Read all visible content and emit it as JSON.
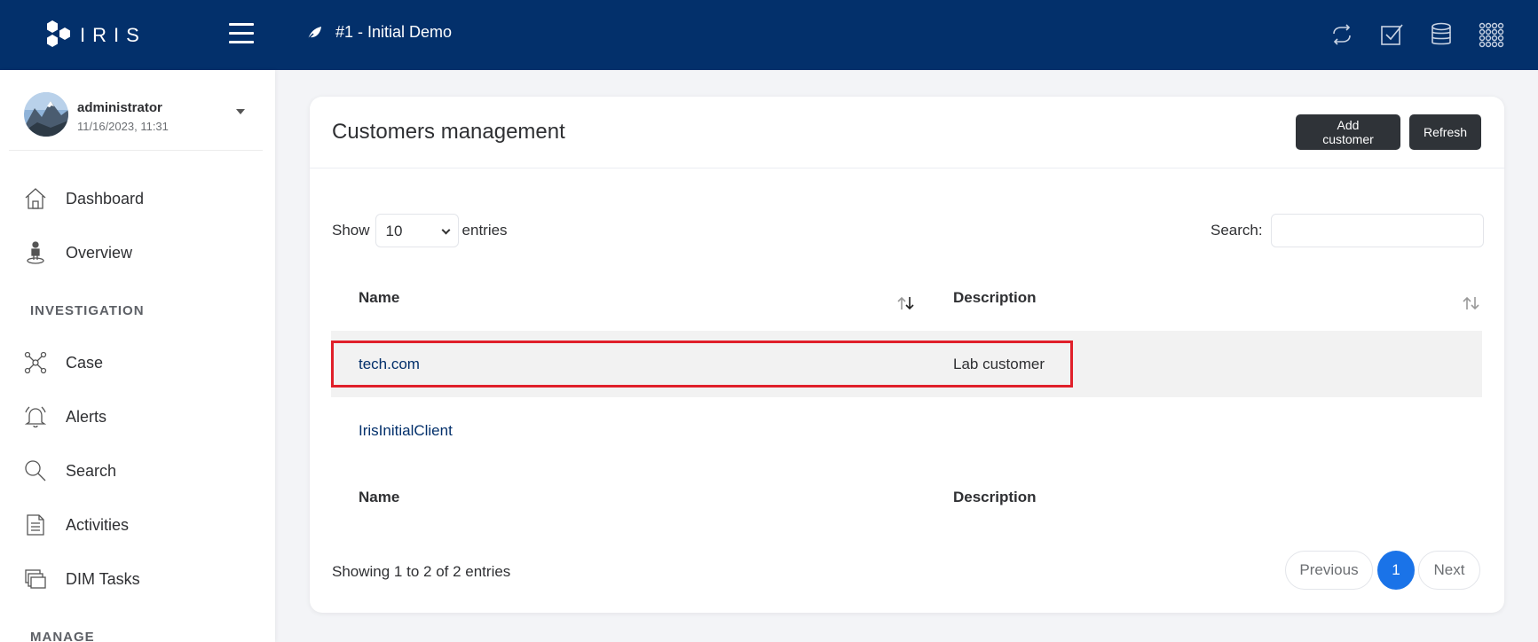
{
  "header": {
    "brand": "IRIS",
    "case_title": "#1 - Initial Demo",
    "icons": [
      "sync-icon",
      "checkbox-icon",
      "database-icon",
      "grid-icon"
    ]
  },
  "user": {
    "name": "administrator",
    "datetime": "11/16/2023, 11:31"
  },
  "sidebar": {
    "items": [
      {
        "label": "Dashboard",
        "icon": "home-icon"
      },
      {
        "label": "Overview",
        "icon": "person-pin-icon"
      }
    ],
    "section_investigation": "INVESTIGATION",
    "investigation_items": [
      {
        "label": "Case",
        "icon": "network-icon"
      },
      {
        "label": "Alerts",
        "icon": "bell-icon"
      },
      {
        "label": "Search",
        "icon": "search-icon"
      },
      {
        "label": "Activities",
        "icon": "list-doc-icon"
      },
      {
        "label": "DIM Tasks",
        "icon": "stack-icon"
      }
    ],
    "section_manage": "MANAGE"
  },
  "main": {
    "title": "Customers management",
    "add_button": "Add customer",
    "refresh_button": "Refresh",
    "show_label": "Show",
    "entries_value": "10",
    "entries_label": "entries",
    "search_label": "Search:",
    "search_value": "",
    "columns": [
      "Name",
      "Description"
    ],
    "rows": [
      {
        "name": "tech.com",
        "description": "Lab customer"
      },
      {
        "name": "IrisInitialClient",
        "description": ""
      }
    ],
    "footer_columns": [
      "Name",
      "Description"
    ],
    "info": "Showing 1 to 2 of 2 entries",
    "pagination": {
      "previous": "Previous",
      "current": "1",
      "next": "Next"
    }
  },
  "colors": {
    "topbar": "#03306b",
    "highlight": "#e0202a",
    "active_page": "#1a73e8"
  }
}
